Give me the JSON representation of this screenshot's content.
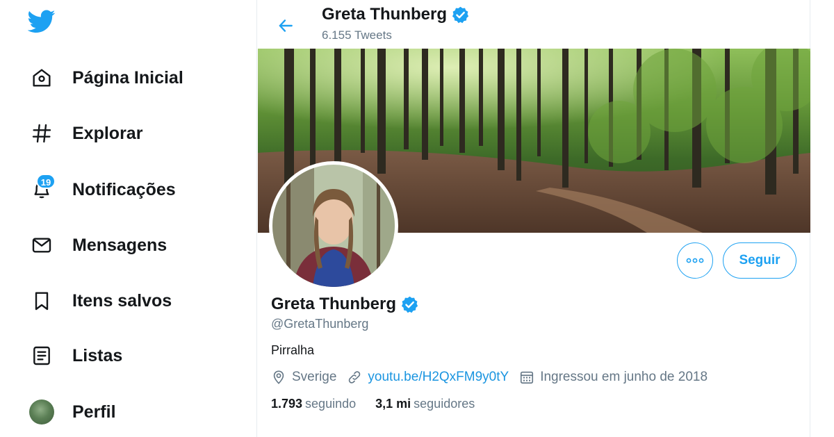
{
  "sidebar": {
    "logo_icon": "twitter-bird-icon",
    "items": [
      {
        "label": "Página Inicial",
        "icon": "home-icon"
      },
      {
        "label": "Explorar",
        "icon": "hashtag-icon"
      },
      {
        "label": "Notificações",
        "icon": "bell-icon",
        "badge": "19"
      },
      {
        "label": "Mensagens",
        "icon": "envelope-icon"
      },
      {
        "label": "Itens salvos",
        "icon": "bookmark-icon"
      },
      {
        "label": "Listas",
        "icon": "list-icon"
      },
      {
        "label": "Perfil",
        "icon": "avatar"
      }
    ]
  },
  "header": {
    "name": "Greta Thunberg",
    "tweet_count": "6.155 Tweets",
    "back_icon": "back-arrow-icon"
  },
  "profile": {
    "name": "Greta Thunberg",
    "handle": "@GretaThunberg",
    "bio": "Pirralha",
    "location": "Sverige",
    "link": "youtu.be/H2QxFM9y0tY",
    "joined": "Ingressou em junho de 2018",
    "following_count": "1.793",
    "following_label": "seguindo",
    "followers_count": "3,1 mi",
    "followers_label": "seguidores",
    "follow_button": "Seguir"
  },
  "colors": {
    "accent": "#1da1f2",
    "link": "#1b95e0",
    "muted": "#657786",
    "text": "#14171a"
  }
}
